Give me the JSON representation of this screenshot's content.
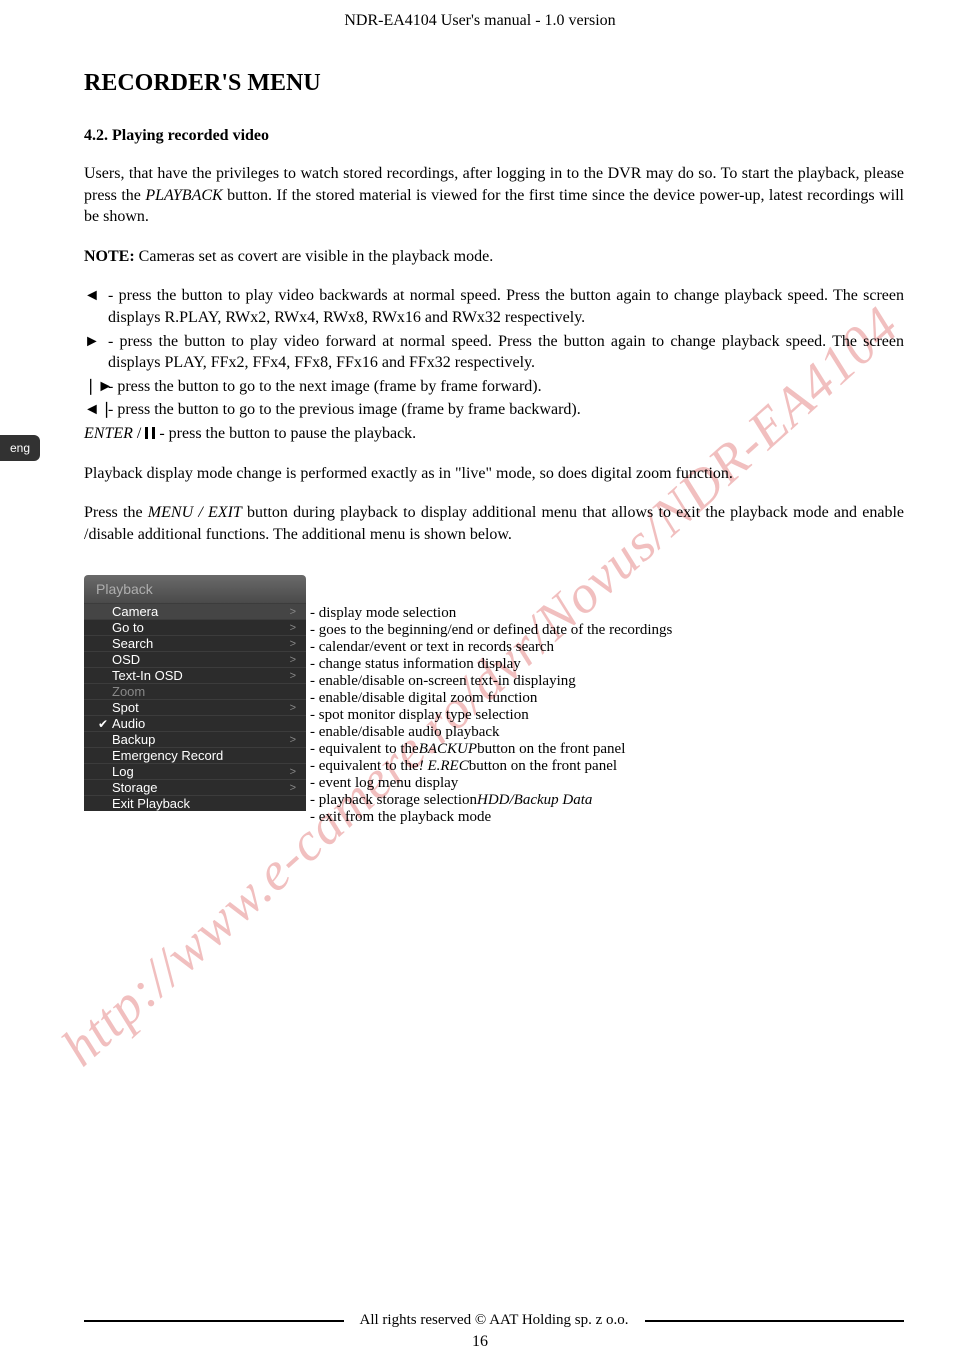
{
  "header": {
    "doc_title": "NDR-EA4104 User's manual - 1.0 version"
  },
  "lang_tab": "eng",
  "section": {
    "title": "RECORDER'S MENU",
    "subsection": "4.2. Playing recorded video"
  },
  "paragraphs": {
    "intro_part1": "Users, that have the privileges to watch stored recordings, after logging in to the DVR may do so. To start the playback, please press the ",
    "intro_playback": "PLAYBACK",
    "intro_part2": " button. If the stored material is viewed for the first time since the device power-up, latest recordings will be shown.",
    "note_label": "NOTE:",
    "note_text": " Cameras set as covert are visible in the playback mode.",
    "b_playbwd": " - press the button to play video backwards at normal speed. Press the button again to change playback speed. The screen displays R.PLAY, RWx2, RWx4, RWx8, RWx16 and RWx32 respectively.",
    "b_playfwd": " - press the button to play video forward at normal speed. Press the button again to change playback speed. The screen displays PLAY, FFx2, FFx4, FFx8, FFx16 and FFx32 respectively.",
    "b_stepfwd": " - press the button to go to the next image (frame by frame forward).",
    "b_stepbwd": " - press the button to go to the previous image (frame by frame backward).",
    "enter_prefix": "ENTER",
    "enter_slash": " / ",
    "enter_rest": " - press the button to pause the playback.",
    "after1": "Playback display mode change is performed exactly as in \"live\" mode, so does digital zoom function.",
    "after2_a": "Press the ",
    "after2_menu": "MENU / EXIT",
    "after2_b": " button during playback to display additional menu that allows to exit the playback mode and enable /disable additional functions. The additional menu is shown below."
  },
  "menu": {
    "header": "Playback",
    "rows": [
      {
        "label": "Camera",
        "arrow": ">",
        "dim": false,
        "check": "",
        "sel": true,
        "desc": "- display mode selection"
      },
      {
        "label": "Go to",
        "arrow": ">",
        "dim": false,
        "check": "",
        "sel": false,
        "desc": "- goes to the beginning/end or defined date of the recordings"
      },
      {
        "label": "Search",
        "arrow": ">",
        "dim": false,
        "check": "",
        "sel": false,
        "desc": "- calendar/event or text in records search"
      },
      {
        "label": "OSD",
        "arrow": ">",
        "dim": false,
        "check": "",
        "sel": false,
        "desc": "- change status information display"
      },
      {
        "label": "Text-In OSD",
        "arrow": ">",
        "dim": false,
        "check": "",
        "sel": false,
        "desc": "- enable/disable on-screen text-in displaying"
      },
      {
        "label": "Zoom",
        "arrow": "",
        "dim": true,
        "check": "",
        "sel": false,
        "desc": "- enable/disable digital zoom function"
      },
      {
        "label": "Spot",
        "arrow": ">",
        "dim": false,
        "check": "",
        "sel": false,
        "desc": "- spot monitor display type selection"
      },
      {
        "label": "Audio",
        "arrow": "",
        "dim": false,
        "check": "✔",
        "sel": false,
        "desc": "- enable/disable audio playback"
      },
      {
        "label": "Backup",
        "arrow": ">",
        "dim": false,
        "check": "",
        "sel": false,
        "desc_pre": "- equivalent to the ",
        "desc_i": "BACKUP",
        "desc_post": " button on the front panel"
      },
      {
        "label": "Emergency Record",
        "arrow": "",
        "dim": false,
        "check": "",
        "sel": false,
        "desc_pre": "- equivalent to the ",
        "desc_i": "! E.REC",
        "desc_post": " button on the front panel"
      },
      {
        "label": "Log",
        "arrow": ">",
        "dim": false,
        "check": "",
        "sel": false,
        "desc": "- event log menu display"
      },
      {
        "label": "Storage",
        "arrow": ">",
        "dim": false,
        "check": "",
        "sel": false,
        "desc_pre": "- playback storage selection ",
        "desc_i": "HDD/Backup Data",
        "desc_post": ""
      },
      {
        "label": "Exit Playback",
        "arrow": "",
        "dim": false,
        "check": "",
        "sel": false,
        "desc": "- exit from the playback mode"
      }
    ]
  },
  "watermark": "http://www.e-camere.ro/dvr/Novus/NDR-EA4104",
  "footer": {
    "text": "All rights reserved © AAT Holding sp. z o.o.",
    "page": "16"
  }
}
